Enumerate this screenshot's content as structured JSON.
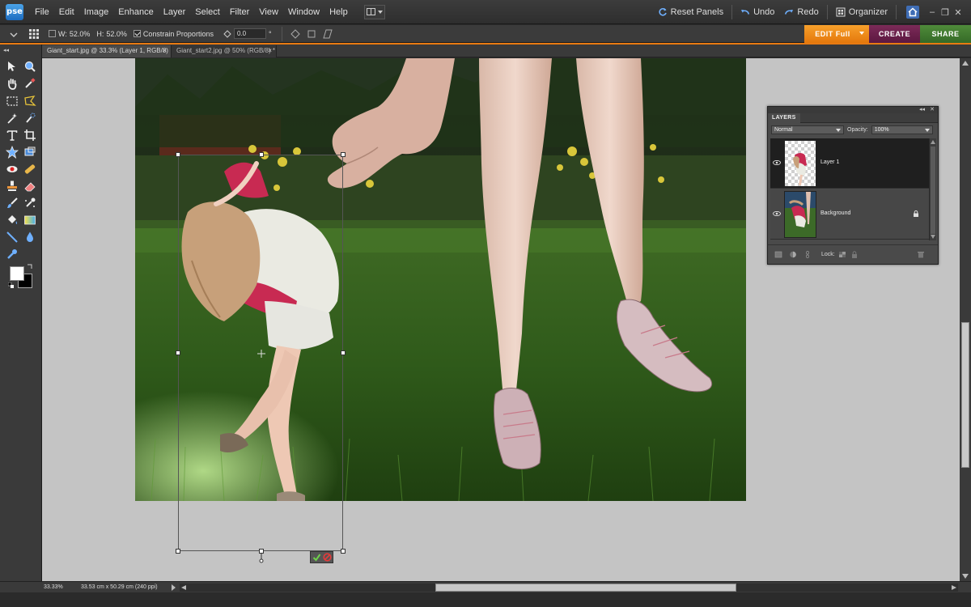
{
  "menubar": {
    "logo": "pse",
    "items": [
      "File",
      "Edit",
      "Image",
      "Enhance",
      "Layer",
      "Select",
      "Filter",
      "View",
      "Window",
      "Help"
    ],
    "reset_panels": "Reset Panels",
    "undo": "Undo",
    "redo": "Redo",
    "organizer": "Organizer"
  },
  "options": {
    "width_label": "W:",
    "width_value": "52.0%",
    "height_label": "H:",
    "height_value": "52.0%",
    "constrain_label": "Constrain Proportions",
    "angle_value": "0.0",
    "degree_symbol": "°"
  },
  "modes": {
    "edit": "EDIT Full",
    "create": "CREATE",
    "share": "SHARE"
  },
  "tabs": [
    {
      "label": "Giant_start.jpg @ 33.3% (Layer 1, RGB/8) *",
      "close": "×"
    },
    {
      "label": "Giant_start2.jpg @ 50% (RGB/8) *",
      "close": "×"
    }
  ],
  "status": {
    "zoom": "33.33%",
    "doc_info": "33.53 cm x 50.29 cm (240 ppi)"
  },
  "layers_panel": {
    "title": "LAYERS",
    "blend_mode": "Normal",
    "opacity_label": "Opacity:",
    "opacity_value": "100%",
    "lock_label": "Lock:",
    "layers": [
      {
        "name": "Layer 1"
      },
      {
        "name": "Background"
      }
    ]
  },
  "colors": {
    "accent_orange": "#e87a12",
    "create_purple": "#5c1840",
    "share_green": "#356a27",
    "canvas_bg": "#c4c4c4"
  },
  "icons": {
    "commit": "checkmark-icon",
    "cancel": "cancel-icon"
  }
}
